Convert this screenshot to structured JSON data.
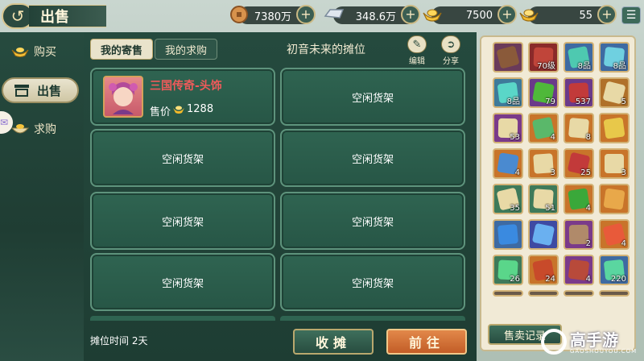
{
  "header": {
    "title": "出售",
    "currencies": [
      {
        "icon": "copper-coin-icon",
        "value": "7380万"
      },
      {
        "icon": "silver-ingot-icon",
        "value": "348.6万"
      },
      {
        "icon": "gold-ingot-icon",
        "value": "7500"
      },
      {
        "icon": "gold-yuanbao-icon",
        "value": "55"
      }
    ],
    "plus_symbol": "+"
  },
  "sidebar": {
    "items": [
      {
        "label": "购买",
        "icon": "gold-ingot-icon"
      },
      {
        "label": "出售",
        "icon": "stall-icon"
      },
      {
        "label": "求购",
        "icon": "bowl-icon"
      }
    ]
  },
  "tabs": [
    "我的寄售",
    "我的求购"
  ],
  "stall": {
    "title": "初音未来的摊位",
    "actions": [
      {
        "label": "编辑",
        "icon": "edit-icon"
      },
      {
        "label": "分享",
        "icon": "share-icon"
      }
    ],
    "listing": {
      "name": "三国传奇-头饰",
      "price_label": "售价",
      "price": "1288"
    },
    "empty_label": "空闲货架",
    "time": "摊位时间 2天"
  },
  "buttons": {
    "close_stall": "收摊",
    "go": "前往",
    "sale_record": "售卖记录"
  },
  "inventory": {
    "counts": [
      "",
      "70级",
      "8品",
      "8品",
      "8品",
      "79",
      "537",
      "5",
      "53",
      "4",
      "8",
      "",
      "4",
      "3",
      "25",
      "3",
      "35",
      "51",
      "4",
      "",
      "",
      "",
      "2",
      "4",
      "26",
      "24",
      "4",
      "220"
    ]
  },
  "brand": {
    "name": "高手游",
    "sub": "GAOSHOUYOU.COM"
  }
}
